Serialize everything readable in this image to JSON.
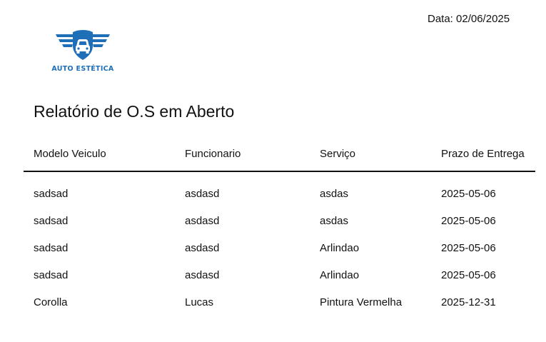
{
  "report": {
    "date_text": "Data: 02/06/2025",
    "title": "Relatório de O.S em Aberto"
  },
  "logo": {
    "icon": "car-wings-icon",
    "text": "AUTO ESTÉTICA",
    "color": "#1f6fb8"
  },
  "table": {
    "columns": [
      "Modelo Veiculo",
      "Funcionario",
      "Serviço",
      "Prazo de Entrega"
    ],
    "rows": [
      [
        "sadsad",
        "asdasd",
        "asdas",
        "2025-05-06"
      ],
      [
        "sadsad",
        "asdasd",
        "asdas",
        "2025-05-06"
      ],
      [
        "sadsad",
        "asdasd",
        "Arlindao",
        "2025-05-06"
      ],
      [
        "sadsad",
        "asdasd",
        "Arlindao",
        "2025-05-06"
      ],
      [
        "Corolla",
        "Lucas",
        "Pintura Vermelha",
        "2025-12-31"
      ]
    ]
  }
}
